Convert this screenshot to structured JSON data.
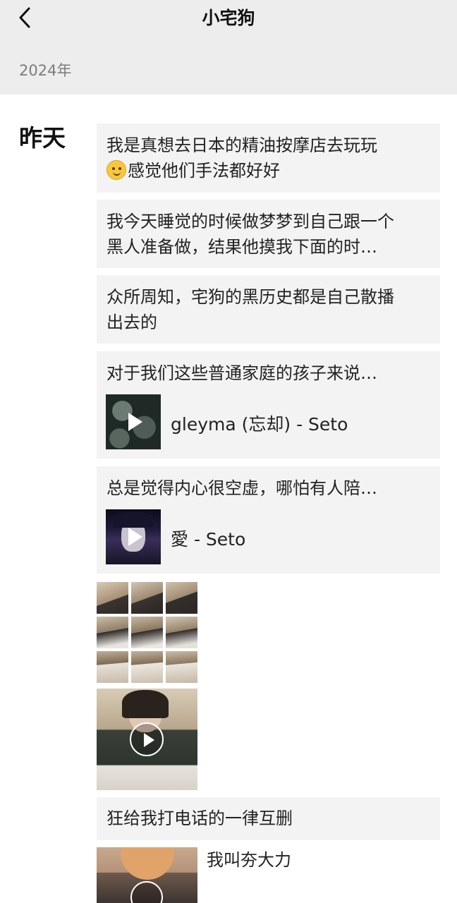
{
  "header": {
    "title": "小宅狗",
    "back_icon": "chevron-left-icon",
    "background": "#ededed"
  },
  "timeline": {
    "year": "2024年",
    "day": "昨天"
  },
  "posts": [
    {
      "type": "text",
      "lines": [
        "我是真想去日本的精油按摩店去玩玩",
        "感觉他们手法都好好"
      ],
      "emoji": "smile-emoji-icon"
    },
    {
      "type": "text",
      "lines": [
        "我今天睡觉的时候做梦梦到自己跟一个",
        "黑人准备做，结果他摸我下面的时…"
      ]
    },
    {
      "type": "text",
      "lines": [
        "众所周知，宅狗的黑历史都是自己散播",
        "出去的"
      ]
    },
    {
      "type": "music",
      "text": "对于我们这些普通家庭的孩子来说…",
      "song": "gleyma (忘却) - Seto",
      "thumb_icon": "play-icon"
    },
    {
      "type": "music",
      "text": "总是觉得内心很空虚，哪怕有人陪…",
      "song": "愛 - Seto",
      "thumb_icon": "play-icon"
    },
    {
      "type": "photo-grid",
      "count": 9
    },
    {
      "type": "video",
      "icon": "play-circle-icon"
    },
    {
      "type": "text",
      "lines": [
        "狂给我打电话的一律互删"
      ]
    },
    {
      "type": "photo",
      "caption": "我叫夯大力"
    }
  ]
}
